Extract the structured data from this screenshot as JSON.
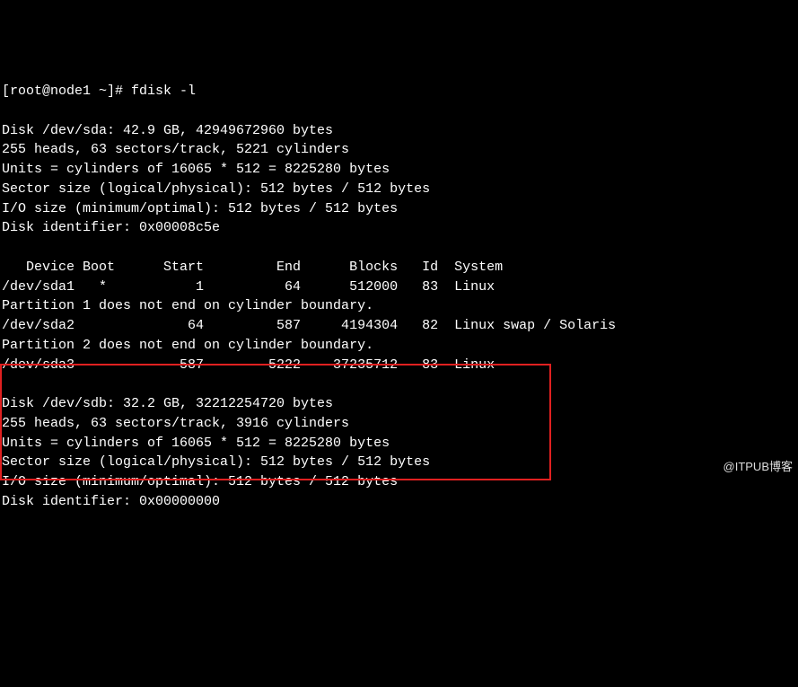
{
  "prompt": "[root@node1 ~]# ",
  "command": "fdisk -l",
  "disk_a": {
    "header": "Disk /dev/sda: 42.9 GB, 42949672960 bytes",
    "geometry": "255 heads, 63 sectors/track, 5221 cylinders",
    "units": "Units = cylinders of 16065 * 512 = 8225280 bytes",
    "sector_size": "Sector size (logical/physical): 512 bytes / 512 bytes",
    "io_size": "I/O size (minimum/optimal): 512 bytes / 512 bytes",
    "identifier": "Disk identifier: 0x00008c5e"
  },
  "partitions": {
    "header": "   Device Boot      Start         End      Blocks   Id  System",
    "rows": [
      "/dev/sda1   *           1          64      512000   83  Linux",
      "Partition 1 does not end on cylinder boundary.",
      "/dev/sda2              64         587     4194304   82  Linux swap / Solaris",
      "Partition 2 does not end on cylinder boundary.",
      "/dev/sda3             587        5222    37235712   83  Linux"
    ]
  },
  "disk_b": {
    "header": "Disk /dev/sdb: 32.2 GB, 32212254720 bytes",
    "geometry": "255 heads, 63 sectors/track, 3916 cylinders",
    "units": "Units = cylinders of 16065 * 512 = 8225280 bytes",
    "sector_size": "Sector size (logical/physical): 512 bytes / 512 bytes",
    "io_size": "I/O size (minimum/optimal): 512 bytes / 512 bytes",
    "identifier": "Disk identifier: 0x00000000"
  },
  "watermark": "@ITPUB博客"
}
